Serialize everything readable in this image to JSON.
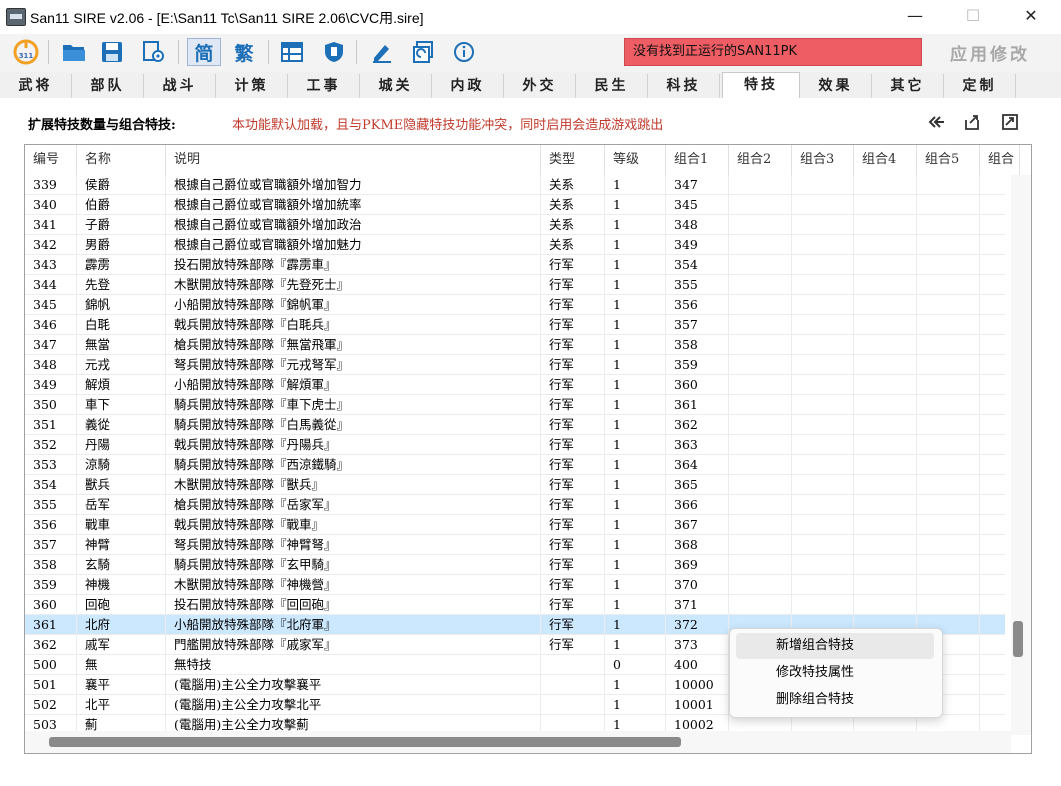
{
  "window": {
    "title": "San11 SIRE v2.06 - [E:\\San11 Tc\\San11 SIRE 2.06\\CVC用.sire]",
    "minimize": "—",
    "maximize": "☐",
    "close": "✕"
  },
  "toolbar": {
    "buttons": [
      "san11-icon",
      "open-folder-icon",
      "save-icon",
      "settings-icon",
      "simplified-icon",
      "traditional-icon",
      "table-icon",
      "shield-icon",
      "edit-icon",
      "refresh-icon",
      "info-icon"
    ],
    "icon_311_label": "311",
    "simplified_label": "简",
    "traditional_label": "繁",
    "status_text": "没有找到正运行的SAN11PK",
    "status_color": "#ee5d63",
    "apply_label": "应用修改"
  },
  "tabs": [
    "武将",
    "部队",
    "战斗",
    "计策",
    "工事",
    "城关",
    "内政",
    "外交",
    "民生",
    "科技",
    "特技",
    "效果",
    "其它",
    "定制"
  ],
  "active_tab": "特技",
  "panel": {
    "title": "扩展特技数量与组合特技:",
    "notice": "本功能默认加载，且与PKME隐藏特技功能冲突，同时启用会造成游戏跳出"
  },
  "table": {
    "columns": [
      "编号",
      "名称",
      "说明",
      "类型",
      "等级",
      "组合1",
      "组合2",
      "组合3",
      "组合4",
      "组合5",
      "组合"
    ],
    "rows": [
      [
        "339",
        "侯爵",
        "根據自己爵位或官職額外增加智力",
        "关系",
        "1",
        "347"
      ],
      [
        "340",
        "伯爵",
        "根據自己爵位或官職額外增加統率",
        "关系",
        "1",
        "345"
      ],
      [
        "341",
        "子爵",
        "根據自己爵位或官職額外增加政治",
        "关系",
        "1",
        "348"
      ],
      [
        "342",
        "男爵",
        "根據自己爵位或官職額外增加魅力",
        "关系",
        "1",
        "349"
      ],
      [
        "343",
        "霹雳",
        "投石開放特殊部隊『霹雳車』",
        "行军",
        "1",
        "354"
      ],
      [
        "344",
        "先登",
        "木獸開放特殊部隊『先登死士』",
        "行军",
        "1",
        "355"
      ],
      [
        "345",
        "錦帆",
        "小船開放特殊部隊『錦帆軍』",
        "行军",
        "1",
        "356"
      ],
      [
        "346",
        "白毦",
        "戟兵開放特殊部隊『白毦兵』",
        "行军",
        "1",
        "357"
      ],
      [
        "347",
        "無當",
        "槍兵開放特殊部隊『無當飛軍』",
        "行军",
        "1",
        "358"
      ],
      [
        "348",
        "元戎",
        "弩兵開放特殊部隊『元戎弩军』",
        "行军",
        "1",
        "359"
      ],
      [
        "349",
        "解煩",
        "小船開放特殊部隊『解煩軍』",
        "行军",
        "1",
        "360"
      ],
      [
        "350",
        "車下",
        "騎兵開放特殊部隊『車下虎士』",
        "行军",
        "1",
        "361"
      ],
      [
        "351",
        "義從",
        "騎兵開放特殊部隊『白馬義從』",
        "行军",
        "1",
        "362"
      ],
      [
        "352",
        "丹陽",
        "戟兵開放特殊部隊『丹陽兵』",
        "行军",
        "1",
        "363"
      ],
      [
        "353",
        "涼騎",
        "騎兵開放特殊部隊『西涼鐵騎』",
        "行军",
        "1",
        "364"
      ],
      [
        "354",
        "獸兵",
        "木獸開放特殊部隊『獸兵』",
        "行军",
        "1",
        "365"
      ],
      [
        "355",
        "岳军",
        "槍兵開放特殊部隊『岳家军』",
        "行军",
        "1",
        "366"
      ],
      [
        "356",
        "戰車",
        "戟兵開放特殊部隊『戰車』",
        "行军",
        "1",
        "367"
      ],
      [
        "357",
        "神臂",
        "弩兵開放特殊部隊『神臂弩』",
        "行军",
        "1",
        "368"
      ],
      [
        "358",
        "玄騎",
        "騎兵開放特殊部隊『玄甲騎』",
        "行军",
        "1",
        "369"
      ],
      [
        "359",
        "神機",
        "木獸開放特殊部隊『神機營』",
        "行军",
        "1",
        "370"
      ],
      [
        "360",
        "回砲",
        "投石開放特殊部隊『回回砲』",
        "行军",
        "1",
        "371"
      ],
      [
        "361",
        "北府",
        "小船開放特殊部隊『北府軍』",
        "行军",
        "1",
        "372"
      ],
      [
        "362",
        "戚军",
        "門艦開放特殊部隊『戚家军』",
        "行军",
        "1",
        "373"
      ],
      [
        "500",
        "無",
        "無特技",
        "",
        "0",
        "400"
      ],
      [
        "501",
        "襄平",
        "(電腦用)主公全力攻擊襄平",
        "",
        "1",
        "10000"
      ],
      [
        "502",
        "北平",
        "(電腦用)主公全力攻擊北平",
        "",
        "1",
        "10001"
      ],
      [
        "503",
        "薊",
        "(電腦用)主公全力攻擊薊",
        "",
        "1",
        "10002"
      ]
    ],
    "selected_id": "361"
  },
  "context_menu": {
    "items": [
      "新增组合特技",
      "修改特技属性",
      "删除组合特技"
    ]
  }
}
